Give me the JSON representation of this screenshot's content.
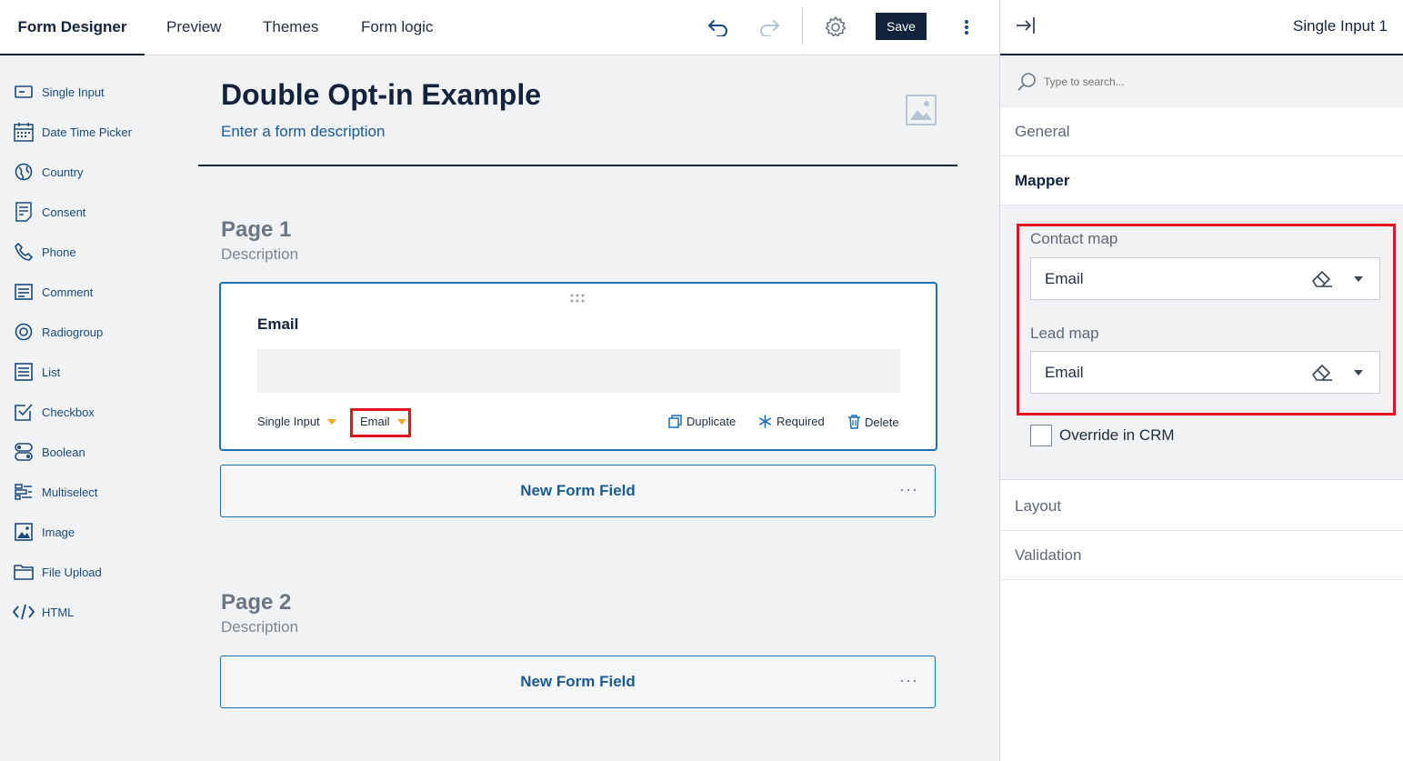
{
  "topbar": {
    "tabs": [
      "Form Designer",
      "Preview",
      "Themes",
      "Form logic"
    ],
    "save_label": "Save",
    "icons": [
      "undo-icon",
      "redo-icon",
      "settings-gear-icon",
      "more-vertical-icon"
    ]
  },
  "toolbox": {
    "items": [
      {
        "label": "Single Input",
        "icon": "single-input-icon"
      },
      {
        "label": "Date Time Picker",
        "icon": "calendar-icon"
      },
      {
        "label": "Country",
        "icon": "globe-icon"
      },
      {
        "label": "Consent",
        "icon": "document-icon"
      },
      {
        "label": "Phone",
        "icon": "phone-icon"
      },
      {
        "label": "Comment",
        "icon": "comment-icon"
      },
      {
        "label": "Radiogroup",
        "icon": "radio-icon"
      },
      {
        "label": "List",
        "icon": "list-icon"
      },
      {
        "label": "Checkbox",
        "icon": "checkbox-icon"
      },
      {
        "label": "Boolean",
        "icon": "toggle-icon"
      },
      {
        "label": "Multiselect",
        "icon": "multiselect-icon"
      },
      {
        "label": "Image",
        "icon": "image-icon"
      },
      {
        "label": "File Upload",
        "icon": "folder-icon"
      },
      {
        "label": "HTML",
        "icon": "code-icon"
      }
    ]
  },
  "form": {
    "title": "Double Opt-in Example",
    "description": "Enter a form description",
    "pages": [
      {
        "title": "Page 1",
        "description": "Description"
      },
      {
        "title": "Page 2",
        "description": "Description"
      }
    ],
    "question": {
      "title": "Email",
      "type_label": "Single Input",
      "mapping_label": "Email",
      "duplicate_label": "Duplicate",
      "required_label": "Required",
      "delete_label": "Delete"
    },
    "new_field_label": "New Form Field",
    "new_field_more": "···"
  },
  "panel": {
    "title": "Single Input 1",
    "search_placeholder": "Type to search...",
    "sections": [
      "General",
      "Mapper",
      "Layout",
      "Validation"
    ],
    "mapper": {
      "contact_map_label": "Contact map",
      "contact_map_value": "Email",
      "lead_map_label": "Lead map",
      "lead_map_value": "Email",
      "override_label": "Override in CRM",
      "override_checked": false
    }
  },
  "colors": {
    "brand_dark": "#14233c",
    "link_blue": "#1a5a96",
    "accent_border": "#1a6fb5",
    "highlight_red": "#e0141e",
    "orange_caret": "#f5a623"
  }
}
